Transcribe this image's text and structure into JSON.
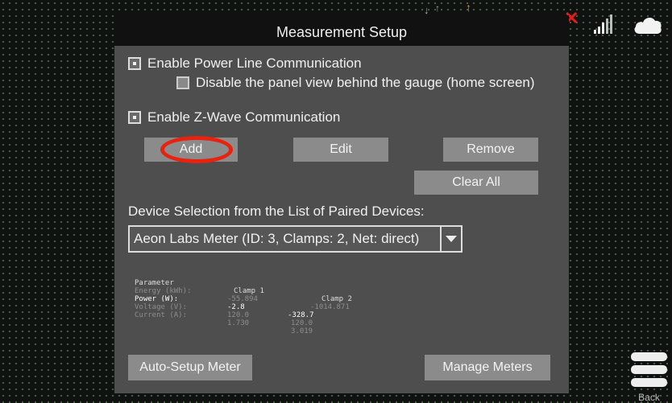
{
  "dialog": {
    "title": "Measurement Setup",
    "enable_plc": {
      "label": "Enable Power Line Communication",
      "checked": true
    },
    "disable_panel": {
      "label": "Disable the panel view behind the gauge (home screen)",
      "checked": false
    },
    "enable_zwave": {
      "label": "Enable Z-Wave Communication",
      "checked": true
    },
    "buttons": {
      "add": "Add",
      "edit": "Edit",
      "remove": "Remove",
      "clear_all": "Clear All"
    },
    "device_selection_label": "Device Selection from the List of Paired Devices:",
    "device_select_value": "Aeon Labs Meter (ID: 3, Clamps: 2, Net: direct)",
    "parameters": {
      "headers": [
        "Parameter",
        "Clamp 1",
        "Clamp 2"
      ],
      "rows": [
        [
          "Energy (kWh):",
          "-55.894",
          "-1014.871"
        ],
        [
          "Power (W):",
          "-2.8",
          "-328.7"
        ],
        [
          "Voltage (V):",
          "120.0",
          "120.0"
        ],
        [
          "Current (A):",
          "1.730",
          "3.019"
        ]
      ]
    },
    "auto_setup": "Auto-Setup Meter",
    "manage_meters": "Manage Meters"
  },
  "back_label": "Back",
  "colors": {
    "highlight": "#e8220f",
    "button": "#8b8b8b",
    "dialog": "#4e4e4e",
    "header": "#111111"
  }
}
